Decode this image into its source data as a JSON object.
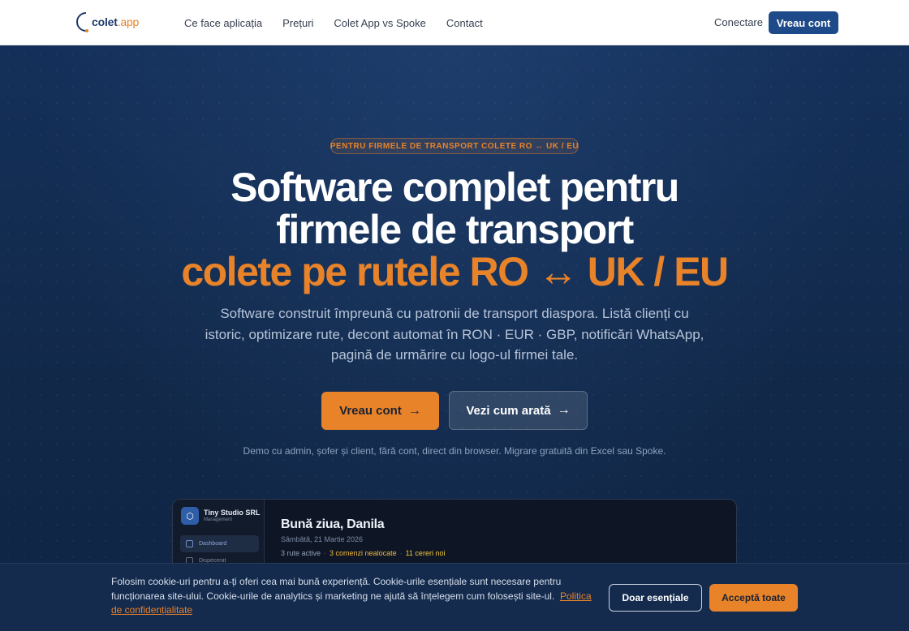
{
  "brand": {
    "name": "colet",
    "ext": ".app",
    "accent": "#e8832a",
    "primary": "#1e4a8a"
  },
  "nav": {
    "links": [
      "Ce face aplicația",
      "Prețuri",
      "Colet App vs Spoke",
      "Contact"
    ],
    "login": "Conectare",
    "cta": "Vreau cont"
  },
  "hero": {
    "eyebrow": "PENTRU FIRMELE DE TRANSPORT COLETE RO ↔ UK / EU",
    "title_line1": "Software complet pentru",
    "title_line2": "firmele de transport",
    "title_line3": "colete pe rutele RO ↔ UK / EU",
    "lead": "Software construit împreună cu patronii de transport diaspora. Listă clienți cu istoric, optimizare rute, decont automat în RON · EUR · GBP, notificări WhatsApp, pagină de urmărire cu logo-ul firmei tale.",
    "primary_cta": "Vreau cont",
    "secondary_cta": "Vezi cum arată",
    "arrow_icon": "arrow-right-icon",
    "note": "Demo cu admin, șofer și client, fără cont, direct din browser. Migrare gratuită din Excel sau Spoke."
  },
  "preview": {
    "company": "Tiny Studio SRL",
    "role": "Management",
    "nav": [
      "Dashboard",
      "Dispecerat"
    ],
    "greeting": "Bună ziua, Danila",
    "date": "Sâmbătă, 21 Martie 2026",
    "stat_routes": "3 rute active",
    "stat_orders": "3 comenzi nealocate",
    "stat_requests": "11 cereri noi",
    "separator": "·"
  },
  "cookie": {
    "text": "Folosim cookie-uri pentru a-ți oferi cea mai bună experiență. Cookie-urile esențiale sunt necesare pentru funcționarea site-ului. Cookie-urile de analytics și marketing ne ajută să înțelegem cum folosești site-ul.",
    "policy_link": "Politica de confidențialitate",
    "essential_button": "Doar esențiale",
    "accept_button": "Acceptă toate"
  }
}
